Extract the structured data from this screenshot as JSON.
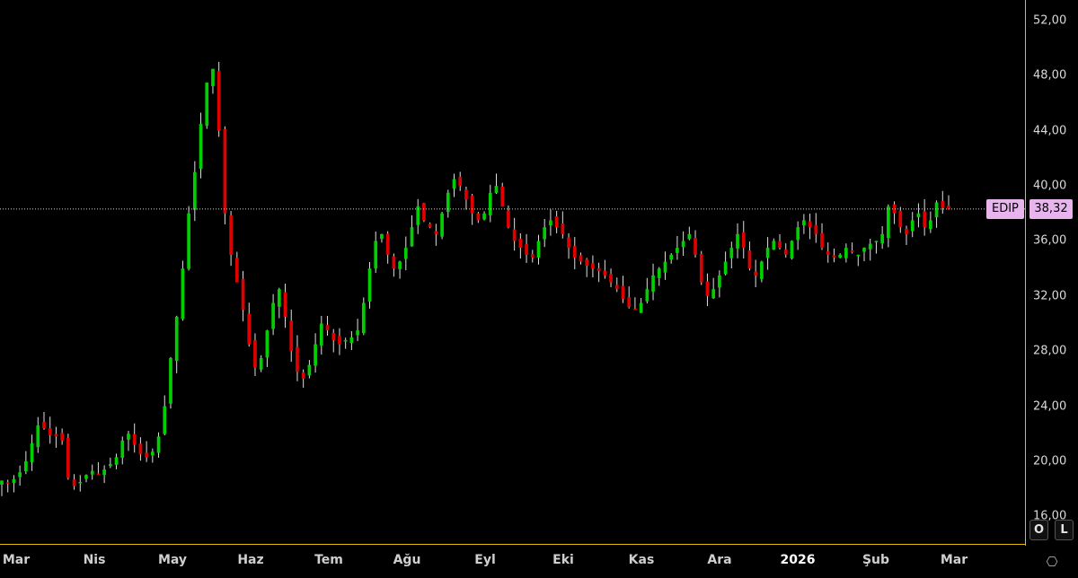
{
  "chart_data": {
    "type": "candlestick",
    "ticker": "EDIP",
    "last_price": "38,32",
    "last_value": 38.32,
    "ylim": [
      14,
      53.5
    ],
    "y_ticks": [
      {
        "v": 52,
        "label": "52,00"
      },
      {
        "v": 48,
        "label": "48,00"
      },
      {
        "v": 44,
        "label": "44,00"
      },
      {
        "v": 40,
        "label": "40,00"
      },
      {
        "v": 36,
        "label": "36,00"
      },
      {
        "v": 32,
        "label": "32,00"
      },
      {
        "v": 28,
        "label": "28,00"
      },
      {
        "v": 24,
        "label": "24,00"
      },
      {
        "v": 20,
        "label": "20,00"
      },
      {
        "v": 16,
        "label": "16,00"
      }
    ],
    "x_ticks": [
      {
        "label": "Mar",
        "bold": false
      },
      {
        "label": "Nis",
        "bold": false
      },
      {
        "label": "May",
        "bold": false
      },
      {
        "label": "Haz",
        "bold": false
      },
      {
        "label": "Tem",
        "bold": false
      },
      {
        "label": "Ağu",
        "bold": false
      },
      {
        "label": "Eyl",
        "bold": false
      },
      {
        "label": "Eki",
        "bold": false
      },
      {
        "label": "Kas",
        "bold": false
      },
      {
        "label": "Ara",
        "bold": false
      },
      {
        "label": "2026",
        "bold": true
      },
      {
        "label": "Şub",
        "bold": false
      },
      {
        "label": "Mar",
        "bold": false
      }
    ],
    "colors": {
      "up": "#00d000",
      "down": "#e00000",
      "wick": "#e0e0e0",
      "axis": "#e0c000",
      "last_line": "#d8d8d8"
    },
    "close_path": [
      18.6,
      18.4,
      18.7,
      19.2,
      20.0,
      21.3,
      22.6,
      22.4,
      21.9,
      21.8,
      21.5,
      18.8,
      18.2,
      18.5,
      19.0,
      19.3,
      19.1,
      19.4,
      19.8,
      20.3,
      21.5,
      22.0,
      21.2,
      20.5,
      20.3,
      20.7,
      21.8,
      24.0,
      27.5,
      30.5,
      34.0,
      38.0,
      41.0,
      44.5,
      47.5,
      48.5,
      44.0,
      38.0,
      35.0,
      33.0,
      31.0,
      28.5,
      26.8,
      27.5,
      29.5,
      31.5,
      32.5,
      30.5,
      28.0,
      26.5,
      26.0,
      27.0,
      28.5,
      30.0,
      29.5,
      28.8,
      28.5,
      28.8,
      29.0,
      29.5,
      31.5,
      34.0,
      36.0,
      36.5,
      35.0,
      34.0,
      34.5,
      35.5,
      37.0,
      38.5,
      37.5,
      37.0,
      36.5,
      38.0,
      39.5,
      40.5,
      40.0,
      39.0,
      38.0,
      37.5,
      38.0,
      39.5,
      40.0,
      38.5,
      37.0,
      36.0,
      35.5,
      35.0,
      34.8,
      36.0,
      37.0,
      37.5,
      37.0,
      36.5,
      35.5,
      34.8,
      34.5,
      34.2,
      34.0,
      33.8,
      33.5,
      33.0,
      32.5,
      31.8,
      31.2,
      31.0,
      31.5,
      32.5,
      33.5,
      34.0,
      34.5,
      35.0,
      35.5,
      36.0,
      36.5,
      35.0,
      33.0,
      32.0,
      32.5,
      33.5,
      34.5,
      35.5,
      36.5,
      35.5,
      34.0,
      33.5,
      34.5,
      35.5,
      36.0,
      35.5,
      35.0,
      36.0,
      37.0,
      37.5,
      37.0,
      36.5,
      35.5,
      35.0,
      34.8,
      35.0,
      35.5,
      35.2,
      35.0,
      35.5,
      35.8,
      36.0,
      36.5,
      38.5,
      38.0,
      37.0,
      36.5,
      37.5,
      38.0,
      37.0,
      37.5,
      38.8,
      38.4,
      38.32
    ]
  },
  "controls": {
    "o_label": "O",
    "l_label": "L",
    "settings_icon": "⎔"
  }
}
